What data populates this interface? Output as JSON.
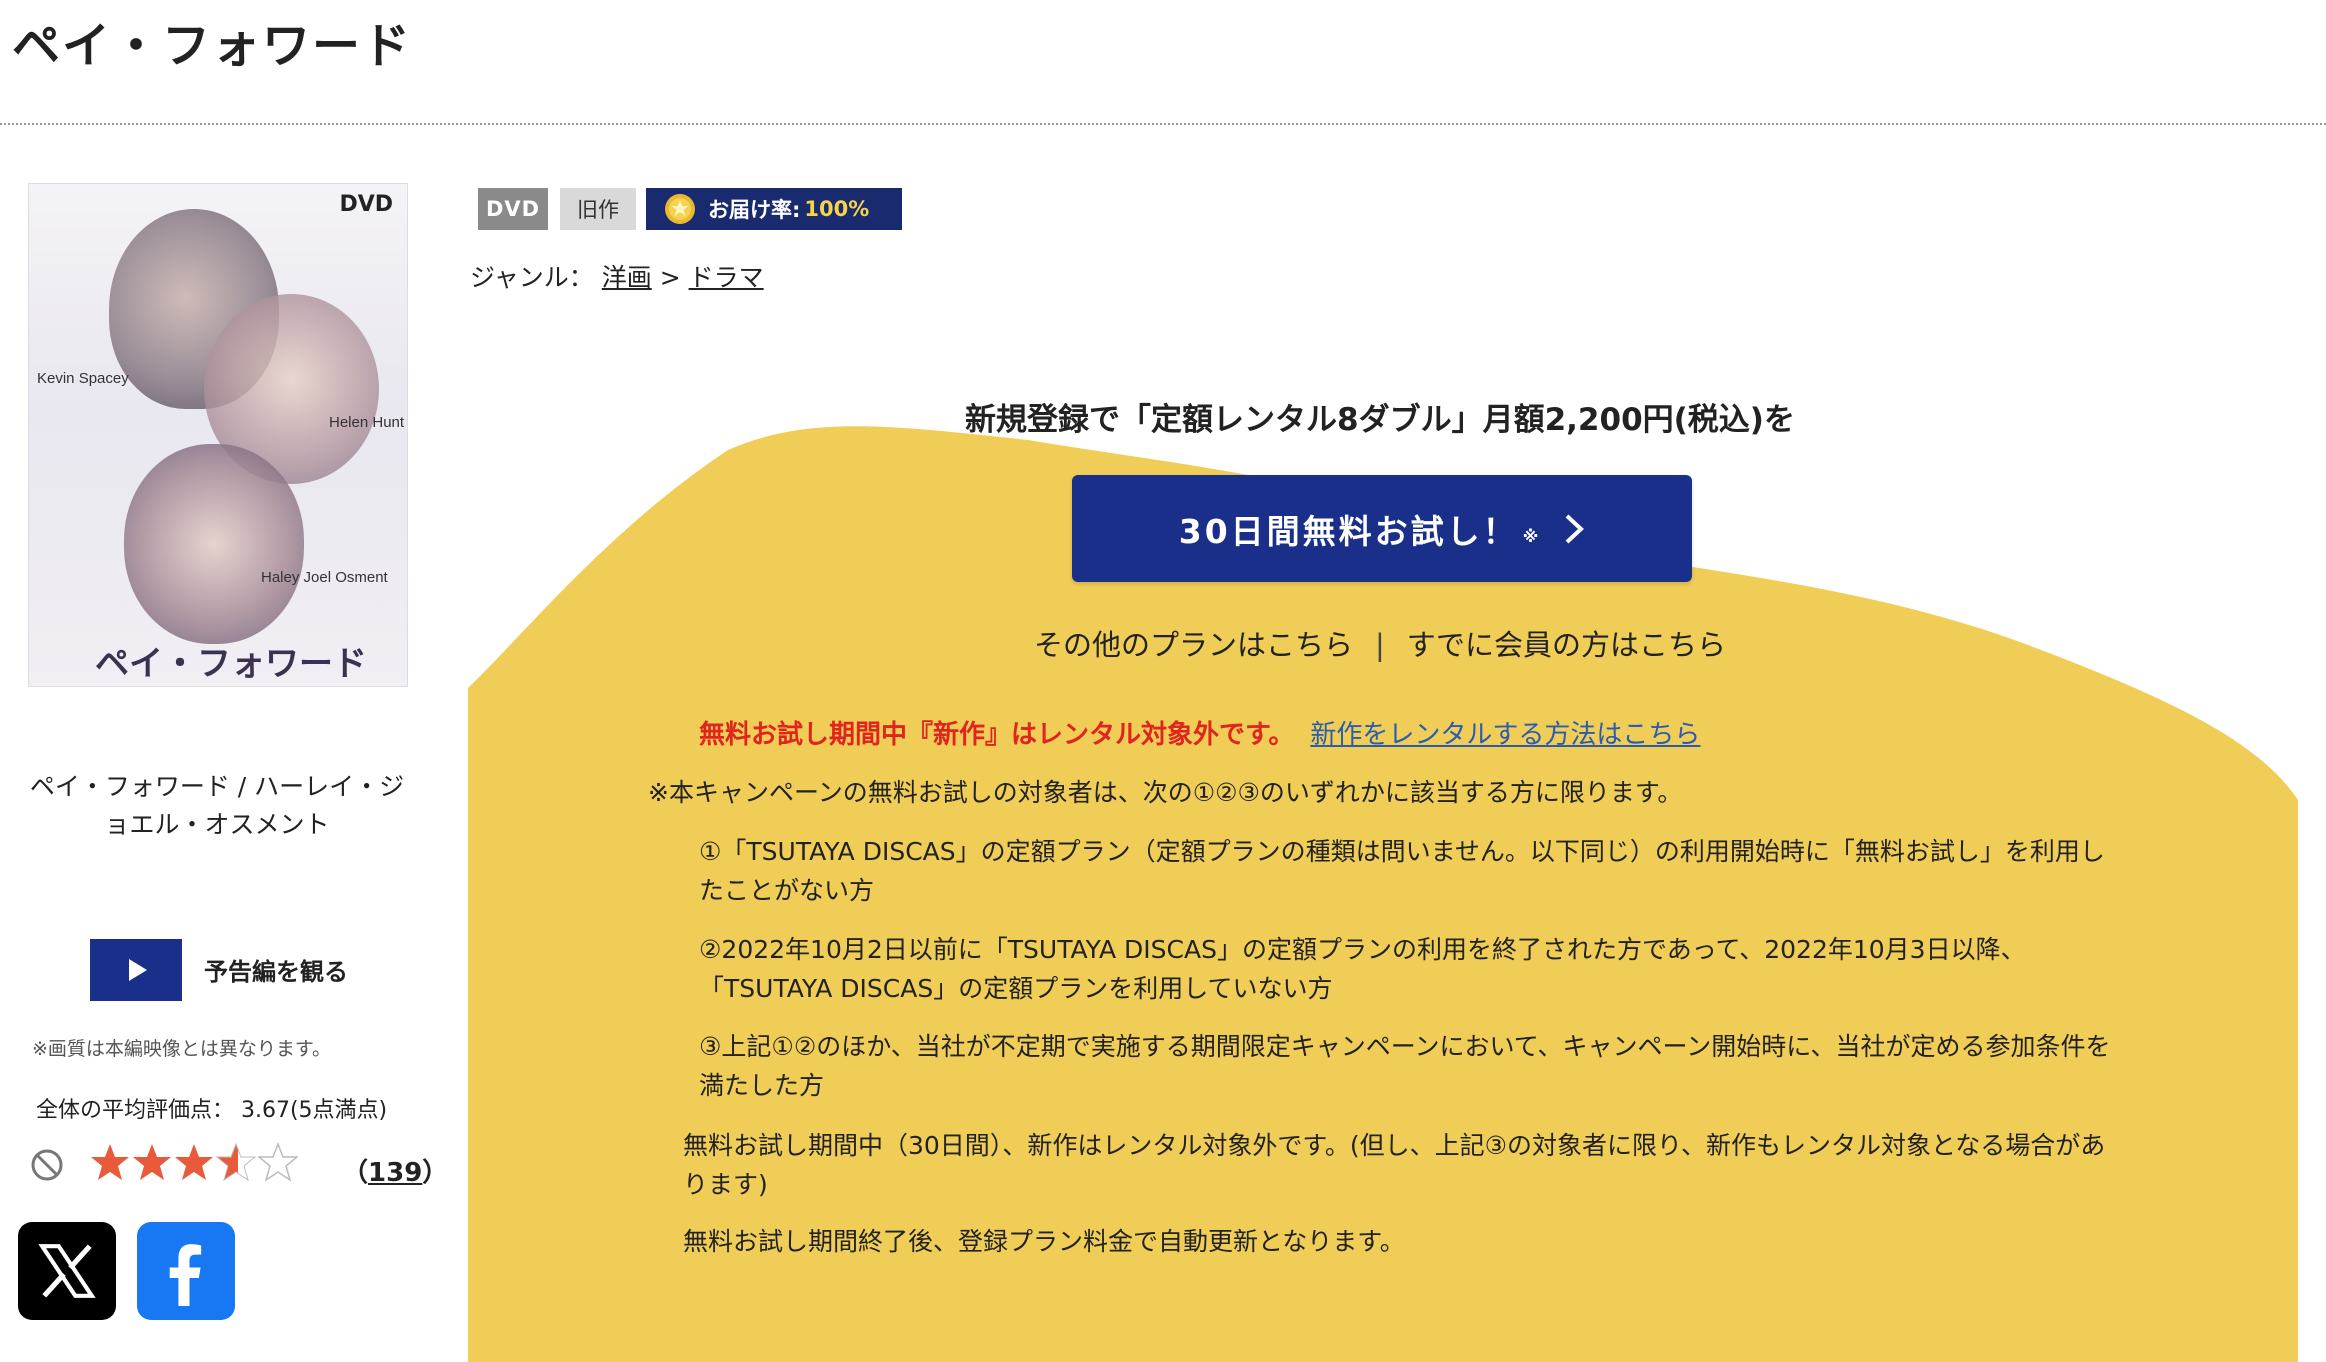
{
  "page": {
    "title": "ペイ・フォワード"
  },
  "cover": {
    "dvd_logo": "DVD",
    "cover_title": "ペイ・フォワード",
    "cast_captions": [
      "Kevin Spacey",
      "Helen Hunt",
      "Haley Joel Osment"
    ],
    "caption": "ペイ・フォワード / ハーレイ・ジョエル・オスメント"
  },
  "trailer": {
    "label": "予告編を観る",
    "note": "※画質は本編映像とは異なります。"
  },
  "rating": {
    "label": "全体の平均評価点： 3.67(5点満点)",
    "average": 3.67,
    "max": 5,
    "count_open": "（",
    "count": "139",
    "count_close": "）"
  },
  "badges": {
    "format": "DVD",
    "type": "旧作",
    "delivery_label": "お届け率:",
    "delivery_value": "100%"
  },
  "genre": {
    "label": "ジャンル：",
    "parent": "洋画",
    "sep": ">",
    "child": "ドラマ"
  },
  "promo": {
    "headline": "新規登録で「定額レンタル8ダブル」月額2,200円(税込)を",
    "cta_label": "30日間無料お試し！",
    "cta_mark": "※",
    "other_plans": "その他のプランはこちら",
    "separator": "|",
    "member_link": "すでに会員の方はこちら",
    "warning": "無料お試し期間中『新作』はレンタル対象外です。",
    "warning_link": "新作をレンタルする方法はこちら",
    "notes": [
      "※本キャンペーンの無料お試しの対象者は、次の①②③のいずれかに該当する方に限ります。",
      "①「TSUTAYA DISCAS」の定額プラン（定額プランの種類は問いません。以下同じ）の利用開始時に「無料お試し」を利用したことがない方",
      "②2022年10月2日以前に「TSUTAYA DISCAS」の定額プランの利用を終了された方であって、2022年10月3日以降、「TSUTAYA DISCAS」の定額プランを利用していない方",
      "③上記①②のほか、当社が不定期で実施する期間限定キャンペーンにおいて、キャンペーン開始時に、当社が定める参加条件を満たした方",
      "無料お試し期間中（30日間）、新作はレンタル対象外です。(但し、上記③の対象者に限り、新作もレンタル対象となる場合があります)",
      "無料お試し期間終了後、登録プラン料金で自動更新となります。"
    ]
  },
  "colors": {
    "navy": "#1a2f8a",
    "yellow": "#f0cd57",
    "red": "#e0251e",
    "link": "#2a5db0",
    "star": "#e85a3a"
  }
}
